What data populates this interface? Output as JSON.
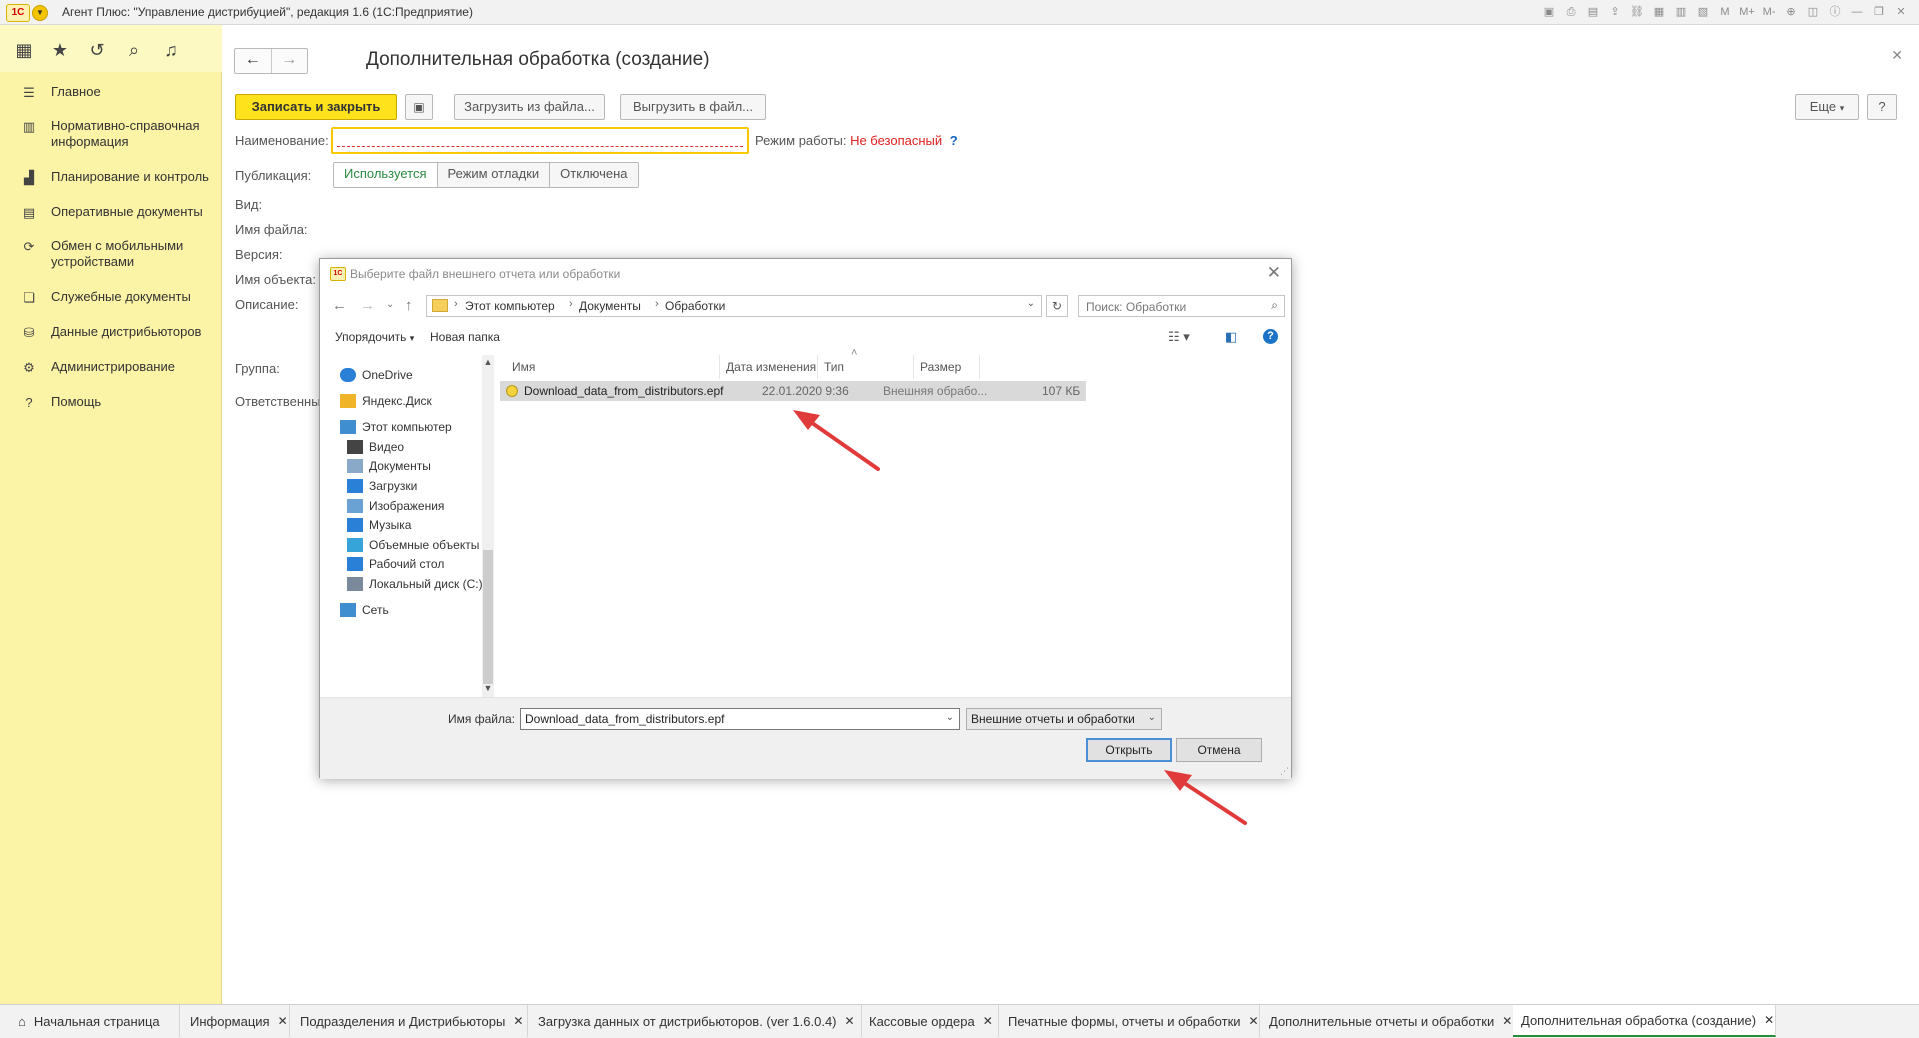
{
  "titlebar": {
    "app_title": "Агент Плюс: \"Управление дистрибуцией\", редакция 1.6  (1С:Предприятие)",
    "logo_text": "1С"
  },
  "sidebar": {
    "items": [
      {
        "label": "Главное",
        "icon": "list-icon"
      },
      {
        "label": "Нормативно-справочная информация",
        "icon": "book-icon"
      },
      {
        "label": "Планирование и контроль",
        "icon": "chart-icon"
      },
      {
        "label": "Оперативные документы",
        "icon": "document-icon"
      },
      {
        "label": "Обмен с мобильными устройствами",
        "icon": "sync-icon"
      },
      {
        "label": "Служебные документы",
        "icon": "documents-icon"
      },
      {
        "label": "Данные дистрибьюторов",
        "icon": "data-icon"
      },
      {
        "label": "Администрирование",
        "icon": "gear-icon"
      },
      {
        "label": "Помощь",
        "icon": "question-icon"
      }
    ]
  },
  "form": {
    "title": "Дополнительная обработка (создание)",
    "save_close": "Записать и закрыть",
    "load_from_file": "Загрузить из файла...",
    "unload_to_file": "Выгрузить в файл...",
    "more": "Еще",
    "help": "?",
    "labels": {
      "name": "Наименование:",
      "publication": "Публикация:",
      "kind": "Вид:",
      "file_name": "Имя файла:",
      "version": "Версия:",
      "object_name": "Имя объекта:",
      "description": "Описание:",
      "group": "Группа:",
      "responsible": "Ответственный:"
    },
    "mode_label": "Режим работы:",
    "mode_value": "Не безопасный",
    "mode_help": "?",
    "publication_options": [
      "Используется",
      "Режим отладки",
      "Отключена"
    ]
  },
  "dialog": {
    "title": "Выберите файл внешнего отчета или обработки",
    "breadcrumbs": [
      "Этот компьютер",
      "Документы",
      "Обработки"
    ],
    "search_placeholder": "Поиск: Обработки",
    "organize": "Упорядочить",
    "new_folder": "Новая папка",
    "nav": [
      {
        "label": "OneDrive",
        "color": "#2a7fd6"
      },
      {
        "label": "Яндекс.Диск",
        "color": "#f0b429"
      },
      {
        "label": "Этот компьютер",
        "color": "#3e8ed0"
      },
      {
        "label": "Видео",
        "color": "#444444"
      },
      {
        "label": "Документы",
        "color": "#8aa9c9"
      },
      {
        "label": "Загрузки",
        "color": "#2a7fd6"
      },
      {
        "label": "Изображения",
        "color": "#6aa2d3"
      },
      {
        "label": "Музыка",
        "color": "#2a7fd6"
      },
      {
        "label": "Объемные объекты",
        "color": "#37a4d9"
      },
      {
        "label": "Рабочий стол",
        "color": "#2a7fd6"
      },
      {
        "label": "Локальный диск (C:)",
        "color": "#7a8a9a"
      },
      {
        "label": "Сеть",
        "color": "#3e8ed0"
      }
    ],
    "columns": [
      "Имя",
      "Дата изменения",
      "Тип",
      "Размер"
    ],
    "files": [
      {
        "name": "Download_data_from_distributors.epf",
        "date": "22.01.2020 9:36",
        "type": "Внешняя обрабо...",
        "size": "107 КБ"
      }
    ],
    "file_name_label": "Имя файла:",
    "file_name_value": "Download_data_from_distributors.epf",
    "file_type": "Внешние отчеты и обработки",
    "open": "Открыть",
    "cancel": "Отмена"
  },
  "taskbar": {
    "tabs": [
      {
        "label": "Начальная страница"
      },
      {
        "label": "Информация"
      },
      {
        "label": "Подразделения и Дистрибьюторы"
      },
      {
        "label": "Загрузка данных от дистрибьюторов. (ver 1.6.0.4)"
      },
      {
        "label": "Кассовые ордера"
      },
      {
        "label": "Печатные формы, отчеты и обработки"
      },
      {
        "label": "Дополнительные отчеты и обработки"
      },
      {
        "label": "Дополнительная обработка (создание)"
      }
    ]
  },
  "colors": {
    "accent_yellow": "#fde21c",
    "sidebar_bg": "#fbf3a6",
    "warning_red": "#e02020",
    "active_green": "#2a8a3e",
    "annotation_arrow": "#e03a3a"
  }
}
